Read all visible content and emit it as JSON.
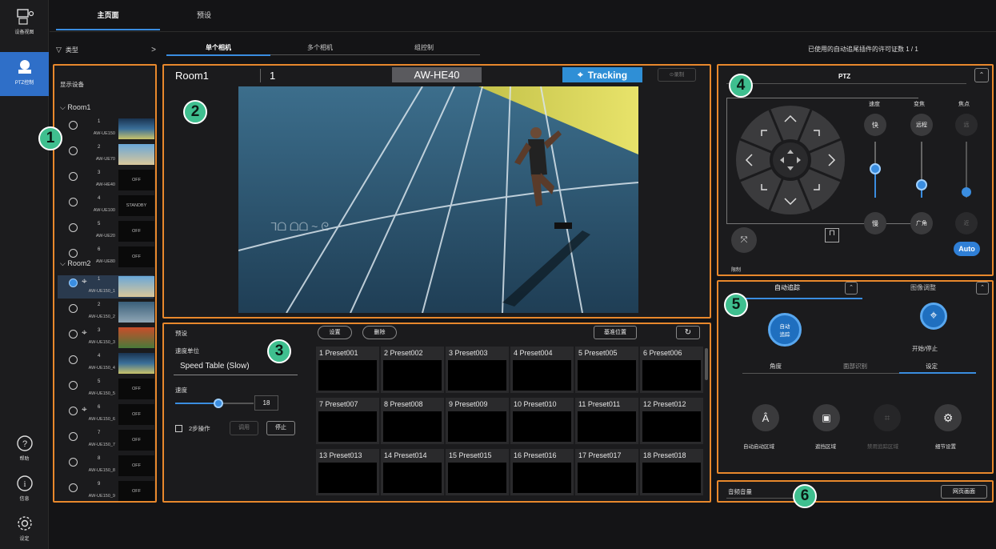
{
  "sidebar": {
    "items": [
      {
        "label": "设备视图",
        "icon": "device-view-icon"
      },
      {
        "label": "PTZ控制",
        "icon": "camera-icon"
      },
      {
        "label": "帮助",
        "icon": "help-icon"
      },
      {
        "label": "信息",
        "icon": "info-icon"
      },
      {
        "label": "设定",
        "icon": "gear-icon"
      }
    ]
  },
  "top_tabs": [
    "主页面",
    "预设"
  ],
  "filter": {
    "label": "类型",
    "chevron": ">"
  },
  "sub_tabs": [
    "单个相机",
    "多个相机",
    "组控制"
  ],
  "license_text": "已使用的自动追尾插件的许可证数  1 / 1",
  "device_list": {
    "header": "显示设备",
    "groups": [
      {
        "name": "Room1",
        "cameras": [
          {
            "num": "1",
            "model": "AW-UE150",
            "thumb": ""
          },
          {
            "num": "2",
            "model": "AW-UE70",
            "thumb": ""
          },
          {
            "num": "3",
            "model": "AW-HE40",
            "thumb": "OFF"
          },
          {
            "num": "4",
            "model": "AW-UE100",
            "thumb": "STANDBY"
          },
          {
            "num": "5",
            "model": "AW-UE20",
            "thumb": "OFF"
          },
          {
            "num": "6",
            "model": "AW-UE80",
            "thumb": "OFF"
          }
        ]
      },
      {
        "name": "Room2",
        "cameras": [
          {
            "num": "1",
            "model": "AW-UE150_1",
            "thumb": ""
          },
          {
            "num": "2",
            "model": "AW-UE150_2",
            "thumb": ""
          },
          {
            "num": "3",
            "model": "AW-UE150_3",
            "thumb": ""
          },
          {
            "num": "4",
            "model": "AW-UE150_4",
            "thumb": ""
          },
          {
            "num": "5",
            "model": "AW-UE150_5",
            "thumb": "OFF"
          },
          {
            "num": "6",
            "model": "AW-UE150_6",
            "thumb": "OFF"
          },
          {
            "num": "7",
            "model": "AW-UE150_7",
            "thumb": "OFF"
          },
          {
            "num": "8",
            "model": "AW-UE150_8",
            "thumb": "OFF"
          },
          {
            "num": "9",
            "model": "AW-UE150_9",
            "thumb": "OFF"
          }
        ]
      }
    ]
  },
  "viewer": {
    "room": "Room1",
    "cam_num": "1",
    "model": "AW-HE40",
    "tracking_label": "Tracking",
    "rec_label": "录制"
  },
  "preset": {
    "title": "预设",
    "set_btn": "设置",
    "delete_btn": "删除",
    "base_btn": "基准位置",
    "speed_unit_label": "速度单位",
    "speed_table": "Speed Table (Slow)",
    "speed_label": "速度",
    "speed_value": "18",
    "speed_level": 0.55,
    "two_step_label": "2步操作",
    "call_btn": "调用",
    "stop_btn": "停止",
    "items": [
      "1  Preset001",
      "2  Preset002",
      "3  Preset003",
      "4  Preset004",
      "5  Preset005",
      "6  Preset006",
      "7  Preset007",
      "8  Preset008",
      "9  Preset009",
      "10  Preset010",
      "11  Preset011",
      "12  Preset012",
      "13  Preset013",
      "14  Preset014",
      "15  Preset015",
      "16  Preset016",
      "17  Preset017",
      "18  Preset018"
    ]
  },
  "ptz": {
    "title": "PTZ",
    "speed_label": "速度",
    "zoom_label": "变焦",
    "focus_label": "焦点",
    "fast": "快",
    "slow": "慢",
    "tele": "远程",
    "wide": "广角",
    "near": "近",
    "far": "远",
    "auto": "Auto",
    "limit_label": "限制"
  },
  "auto_track": {
    "tab1": "自动追踪",
    "tab2": "图像调整",
    "auto_btn": "自动\n追踪",
    "start_stop": "开始/停止",
    "sub_tabs": [
      "角度",
      "面部识别",
      "设定"
    ],
    "actions": [
      "自动启动区域",
      "遮挡区域",
      "禁用追踪区域",
      "细节设置"
    ]
  },
  "audio": {
    "label": "音频音量",
    "web_btn": "网页画面"
  },
  "badges": [
    "1",
    "2",
    "3",
    "4",
    "5",
    "6"
  ],
  "colors": {
    "accent": "#3a8de0",
    "highlight": "#e8882c",
    "badge": "#3fbf8f",
    "tracking": "#2f8fd6"
  }
}
